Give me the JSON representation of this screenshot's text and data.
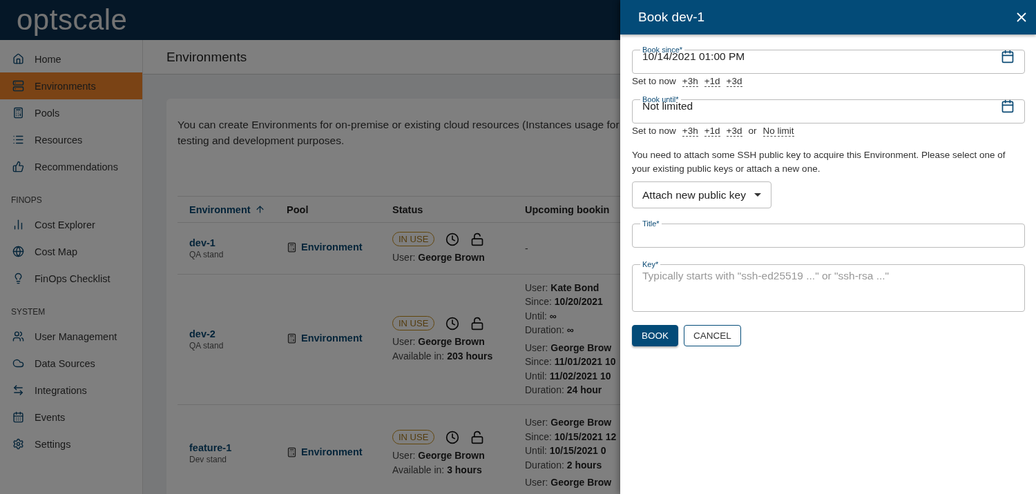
{
  "app": {
    "logo": "optscale"
  },
  "sidebar": {
    "groups": [
      {
        "items": [
          {
            "label": "Home",
            "selected": false
          },
          {
            "label": "Environments",
            "selected": true
          },
          {
            "label": "Pools",
            "selected": false
          },
          {
            "label": "Resources",
            "selected": false
          },
          {
            "label": "Recommendations",
            "selected": false
          }
        ]
      },
      {
        "heading": "FINOPS",
        "items": [
          {
            "label": "Cost Explorer",
            "selected": false
          },
          {
            "label": "Cost Map",
            "selected": false
          },
          {
            "label": "FinOps Checklist",
            "selected": false
          }
        ]
      },
      {
        "heading": "SYSTEM",
        "items": [
          {
            "label": "User Management",
            "selected": false
          },
          {
            "label": "Data Sources",
            "selected": false
          },
          {
            "label": "Integrations",
            "selected": false
          },
          {
            "label": "Events",
            "selected": false
          },
          {
            "label": "Settings",
            "selected": false
          }
        ]
      }
    ]
  },
  "page": {
    "title": "Environments",
    "description": "You can create Environments for on-premise or existing cloud resources (Instances usage for testing and development purposes.",
    "table": {
      "columns": [
        {
          "label": "Environment",
          "sorted": true
        },
        {
          "label": "Pool",
          "sorted": false
        },
        {
          "label": "Status",
          "sorted": false
        },
        {
          "label": "Upcoming bookin",
          "sorted": false
        }
      ],
      "rows": [
        {
          "name": "dev-1",
          "stand": "QA stand",
          "pool": "Environment",
          "status": "IN USE",
          "user": "User: **George Brown**",
          "bookings": [],
          "empty": "-"
        },
        {
          "name": "dev-2",
          "stand": "QA stand",
          "pool": "Environment",
          "status": "IN USE",
          "user": "User: **George Brown**",
          "available": "Available in: **203 hours**",
          "bookings": [
            [
              "User: **Kate Bond**",
              "Since: **10/20/2021**",
              "Until: **∞**",
              "Duration: **∞**"
            ],
            [
              "User: **George Brow**",
              "Since: **11/01/2021 10**",
              "Until: **11/02/2021 10**",
              "Duration: **24 hour**"
            ]
          ]
        },
        {
          "name": "feature-1",
          "stand": "Dev stand",
          "pool": "Environment",
          "status": "IN USE",
          "user": "User: **George Brown**",
          "available": "Available in: **3 hours**",
          "bookings": [
            [
              "User: **George Brow**",
              "Since: **10/15/2021 12**",
              "Until: **10/15/2021 0**",
              "Duration: **2 hours**"
            ],
            [
              "User: **George Brow**"
            ]
          ]
        }
      ]
    }
  },
  "drawer": {
    "title": "Book dev-1",
    "fields": [
      {
        "kind": "datetime",
        "label": "Book since*",
        "value": "10/14/2021 01:00 PM",
        "shortcuts": [
          {
            "kind": "action",
            "label": "Set to now"
          },
          {
            "kind": "dashed",
            "label": "+3h"
          },
          {
            "kind": "dashed",
            "label": "+1d"
          },
          {
            "kind": "dashed",
            "label": "+3d"
          }
        ]
      },
      {
        "kind": "datetime",
        "label": "Book until*",
        "value": "Not limited",
        "shortcuts": [
          {
            "kind": "action",
            "label": "Set to now"
          },
          {
            "kind": "dashed",
            "label": "+3h"
          },
          {
            "kind": "dashed",
            "label": "+1d"
          },
          {
            "kind": "dashed",
            "label": "+3d"
          },
          {
            "kind": "text",
            "label": "or"
          },
          {
            "kind": "dashed",
            "label": "No limit"
          }
        ]
      },
      {
        "kind": "notice",
        "text": "You need to attach some SSH public key to acquire this Environment. Please select one of your existing public keys or attach a new one."
      },
      {
        "kind": "select",
        "value": "Attach new public key"
      },
      {
        "kind": "text",
        "label": "Title*"
      },
      {
        "kind": "textarea",
        "label": "Key*",
        "placeholder": "Typically starts with \"ssh-ed25519 ...\" or \"ssh-rsa ...\""
      }
    ],
    "buttons": [
      {
        "label": "BOOK",
        "kind": "primary"
      },
      {
        "label": "CANCEL",
        "kind": "outlined"
      }
    ]
  }
}
